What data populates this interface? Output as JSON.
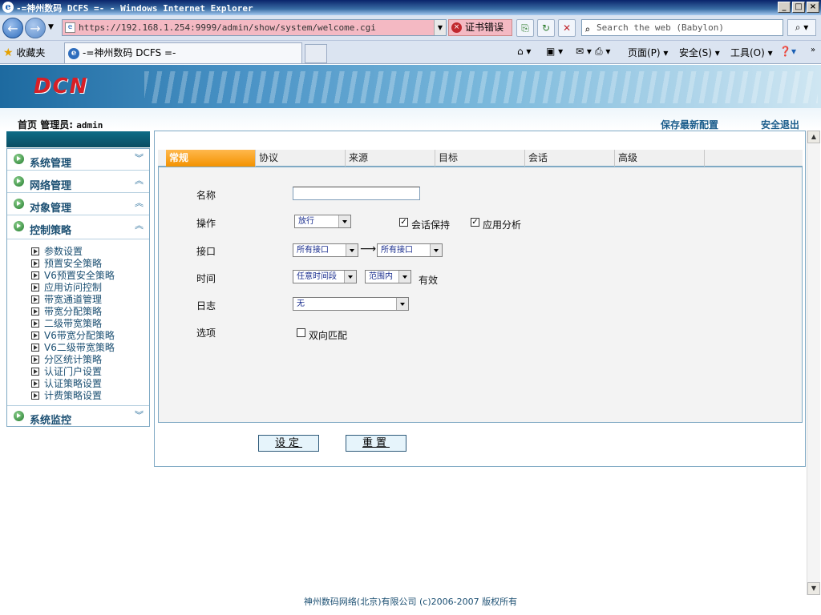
{
  "window": {
    "title": "-=神州数码 DCFS =- - Windows Internet Explorer"
  },
  "browser": {
    "url": "https://192.168.1.254:9999/admin/show/system/welcome.cgi",
    "cert_error": "证书错误",
    "search_placeholder": "Search the web (Babylon)",
    "favorites": "收藏夹",
    "tab_title": "-=神州数码 DCFS =-",
    "cmd_page": "页面(P)",
    "cmd_safety": "安全(S)",
    "cmd_tools": "工具(O)"
  },
  "header": {
    "logo": "DCN",
    "home": "首页",
    "admin_label": "管理员:",
    "admin_name": "admin",
    "save_config": "保存最新配置",
    "logout": "安全退出"
  },
  "sidebar": {
    "sections": [
      {
        "label": "系统管理"
      },
      {
        "label": "网络管理"
      },
      {
        "label": "对象管理"
      },
      {
        "label": "控制策略"
      },
      {
        "label": "系统监控"
      }
    ],
    "sub_items": [
      "参数设置",
      "预置安全策略",
      "V6预置安全策略",
      "应用访问控制",
      "带宽通道管理",
      "带宽分配策略",
      "二级带宽策略",
      "V6带宽分配策略",
      "V6二级带宽策略",
      "分区统计策略",
      "认证门户设置",
      "认证策略设置",
      "计费策略设置"
    ]
  },
  "tabs": [
    "常规",
    "协议",
    "来源",
    "目标",
    "会话",
    "高级"
  ],
  "form": {
    "name_label": "名称",
    "name_value": "",
    "action_label": "操作",
    "action_value": "放行",
    "session_keep": "会话保持",
    "session_keep_checked": true,
    "app_analysis": "应用分析",
    "app_analysis_checked": true,
    "interface_label": "接口",
    "if_from": "所有接口",
    "if_to": "所有接口",
    "time_label": "时间",
    "time_value": "任意时间段",
    "time_scope": "范围内",
    "time_effective": "有效",
    "log_label": "日志",
    "log_value": "无",
    "options_label": "选项",
    "bidirectional": "双向匹配",
    "bidirectional_checked": false
  },
  "buttons": {
    "set": "设定",
    "reset": "重置"
  },
  "footer": "神州数码网络(北京)有限公司 (c)2006-2007 版权所有"
}
